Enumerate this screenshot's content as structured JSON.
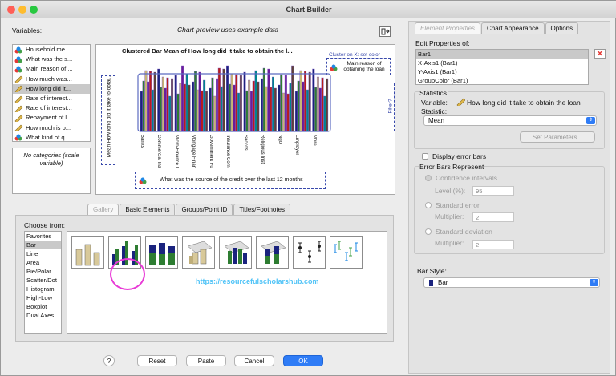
{
  "window": {
    "title": "Chart Builder"
  },
  "left": {
    "variables_label": "Variables:",
    "preview_note": "Chart preview uses example data",
    "variables": [
      {
        "label": "Household me...",
        "type": "nominal"
      },
      {
        "label": "What was the s...",
        "type": "nominal"
      },
      {
        "label": "Main reason of ...",
        "type": "nominal"
      },
      {
        "label": "How much was...",
        "type": "scale"
      },
      {
        "label": "How long did it...",
        "type": "scale"
      },
      {
        "label": "Rate of interest...",
        "type": "scale"
      },
      {
        "label": "Rate of interest...",
        "type": "scale"
      },
      {
        "label": "Repayment of l...",
        "type": "scale"
      },
      {
        "label": "How much  is o...",
        "type": "scale"
      },
      {
        "label": "What kind of q...",
        "type": "nominal"
      }
    ],
    "categories_text": "No categories (scale variable)"
  },
  "preview": {
    "title": "Clustered Bar Mean of How long did it take to obtain the l...",
    "cluster_label": "Cluster on X: set color",
    "cluster_var": "Main reason of obtaining the loan",
    "y_axis_label": "Mean How long did it take to obtai...",
    "filter_label": "Filter?",
    "x_axis_label": "What was the source of the credit over the last 12 months",
    "x_categories": [
      "Banks",
      "Commercial Inst",
      "Micro-Finance Inst",
      "Mortgage Finance",
      "Government Funds",
      "Insurance Company",
      "Saccos",
      "Religious Inst",
      "Ngo",
      "Employer",
      "More..."
    ]
  },
  "gallery_tabs": [
    "Gallery",
    "Basic Elements",
    "Groups/Point ID",
    "Titles/Footnotes"
  ],
  "choose_from_label": "Choose from:",
  "chart_types": [
    "Favorites",
    "Bar",
    "Line",
    "Area",
    "Pie/Polar",
    "Scatter/Dot",
    "Histogram",
    "High-Low",
    "Boxplot",
    "Dual Axes"
  ],
  "selected_type": "Bar",
  "thumbnails": [
    "simple-bar",
    "clustered-bar",
    "stacked-bar",
    "3d-bar",
    "3d-clustered-bar",
    "3d-stacked-bar",
    "error-bar",
    "clustered-error-bar"
  ],
  "watermark": "https://resourcefulscholarshub.com",
  "buttons": {
    "help": "?",
    "reset": "Reset",
    "paste": "Paste",
    "cancel": "Cancel",
    "ok": "OK"
  },
  "right": {
    "tabs": [
      "Element Properties",
      "Chart Appearance",
      "Options"
    ],
    "edit_label": "Edit Properties of:",
    "elements": [
      "Bar1",
      "X-Axis1 (Bar1)",
      "Y-Axis1 (Bar1)",
      "GroupColor (Bar1)"
    ],
    "statistics_label": "Statistics",
    "variable_label": "Variable:",
    "variable_value": "How long did it take to obtain the loan",
    "statistic_label": "Statistic:",
    "statistic_value": "Mean",
    "set_params": "Set Parameters...",
    "display_error_bars": "Display error bars",
    "error_bars_represent": "Error Bars Represent",
    "confidence_intervals": "Confidence intervals",
    "level_label": "Level (%):",
    "level_value": "95",
    "standard_error": "Standard error",
    "multiplier_label": "Multiplier:",
    "se_multiplier": "2",
    "standard_deviation": "Standard deviation",
    "sd_multiplier": "2",
    "bar_style_label": "Bar Style:",
    "bar_style_value": "Bar"
  },
  "colors": {
    "accent": "#2f7cf6",
    "highlight_ring": "#e83ad6",
    "dash": "#3949ab",
    "close_red": "#ff5f57",
    "min_yellow": "#febc2e",
    "max_green": "#28c840"
  }
}
